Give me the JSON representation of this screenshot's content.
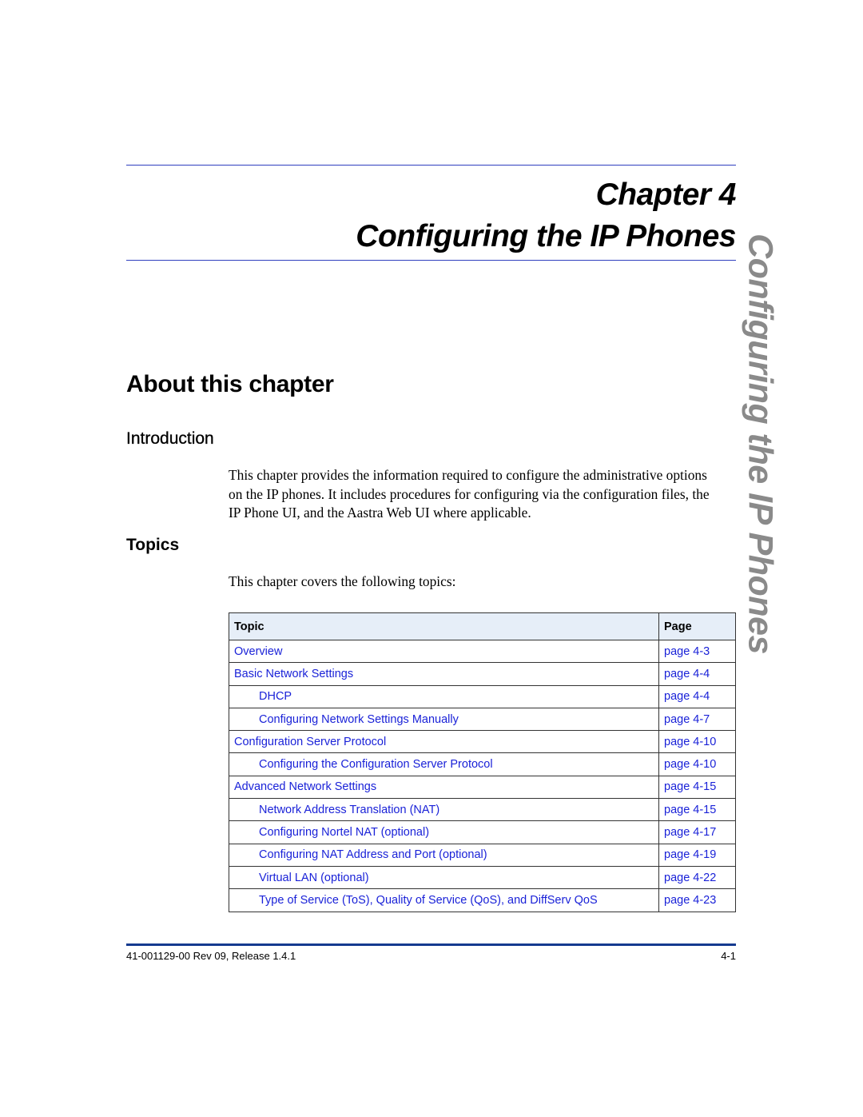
{
  "chapter": {
    "label": "Chapter 4",
    "title": "Configuring the IP Phones",
    "side_tab": "Configuring the IP Phones"
  },
  "sections": {
    "about_heading": "About this chapter",
    "intro_heading": "Introduction",
    "intro_text": "This chapter provides the information required to configure the administrative options on the IP phones. It includes procedures for configuring via the configuration files, the IP Phone UI, and the Aastra Web UI where applicable.",
    "topics_heading": "Topics",
    "topics_lead": "This chapter covers the following topics:"
  },
  "table": {
    "headers": [
      "Topic",
      "Page"
    ],
    "rows": [
      {
        "topic": "Overview",
        "page": "page 4-3",
        "indent": false
      },
      {
        "topic": "Basic Network Settings",
        "page": "page 4-4",
        "indent": false
      },
      {
        "topic": "DHCP",
        "page": "page 4-4",
        "indent": true
      },
      {
        "topic": "Configuring Network Settings Manually",
        "page": "page 4-7",
        "indent": true
      },
      {
        "topic": "Configuration Server Protocol",
        "page": "page 4-10",
        "indent": false
      },
      {
        "topic": "Configuring the Configuration Server Protocol",
        "page": "page 4-10",
        "indent": true
      },
      {
        "topic": "Advanced Network Settings",
        "page": "page 4-15",
        "indent": false
      },
      {
        "topic": "Network Address Translation (NAT)",
        "page": "page 4-15",
        "indent": true
      },
      {
        "topic": "Configuring Nortel NAT (optional)",
        "page": "page 4-17",
        "indent": true
      },
      {
        "topic": "Configuring NAT Address and Port (optional)",
        "page": "page 4-19",
        "indent": true
      },
      {
        "topic": "Virtual LAN (optional)",
        "page": "page 4-22",
        "indent": true
      },
      {
        "topic": "Type of Service (ToS), Quality of Service (QoS), and DiffServ QoS",
        "page": "page 4-23",
        "indent": true
      }
    ]
  },
  "footer": {
    "doc_id": "41-001129-00 Rev 09, Release 1.4.1",
    "page_number": "4-1"
  },
  "colors": {
    "link": "#1a22d8",
    "rule": "#2f3fbf",
    "footer_rule": "#153a8f",
    "table_header_bg": "#e6eef8",
    "side_tab": "#8a8a8a"
  }
}
